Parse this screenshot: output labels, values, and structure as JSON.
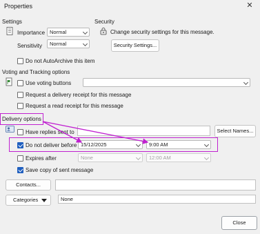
{
  "window": {
    "title": "Properties"
  },
  "settings": {
    "heading": "Settings",
    "importance_label": "Importance",
    "importance_value": "Normal",
    "sensitivity_label": "Sensitivity",
    "sensitivity_value": "Normal",
    "autoarchive_label": "Do not AutoArchive this item"
  },
  "security": {
    "heading": "Security",
    "description": "Change security settings for this message.",
    "button_label": "Security Settings..."
  },
  "voting": {
    "heading": "Voting and Tracking options",
    "use_voting_label": "Use voting buttons",
    "delivery_receipt_label": "Request a delivery receipt for this message",
    "read_receipt_label": "Request a read receipt for this message"
  },
  "delivery": {
    "heading": "Delivery options",
    "replies_label": "Have replies sent to",
    "select_names_label": "Select Names...",
    "do_not_deliver_label": "Do not deliver before",
    "do_not_deliver_date": "15/12/2025",
    "do_not_deliver_time": "9:00 AM",
    "expires_label": "Expires after",
    "expires_date": "None",
    "expires_time": "12:00 AM",
    "save_copy_label": "Save copy of sent message"
  },
  "footer": {
    "contacts_label": "Contacts...",
    "categories_label": "Categories",
    "categories_value": "None",
    "close_label": "Close"
  },
  "colors": {
    "accent": "#1f5fbf",
    "annotation": "#c020d0"
  }
}
